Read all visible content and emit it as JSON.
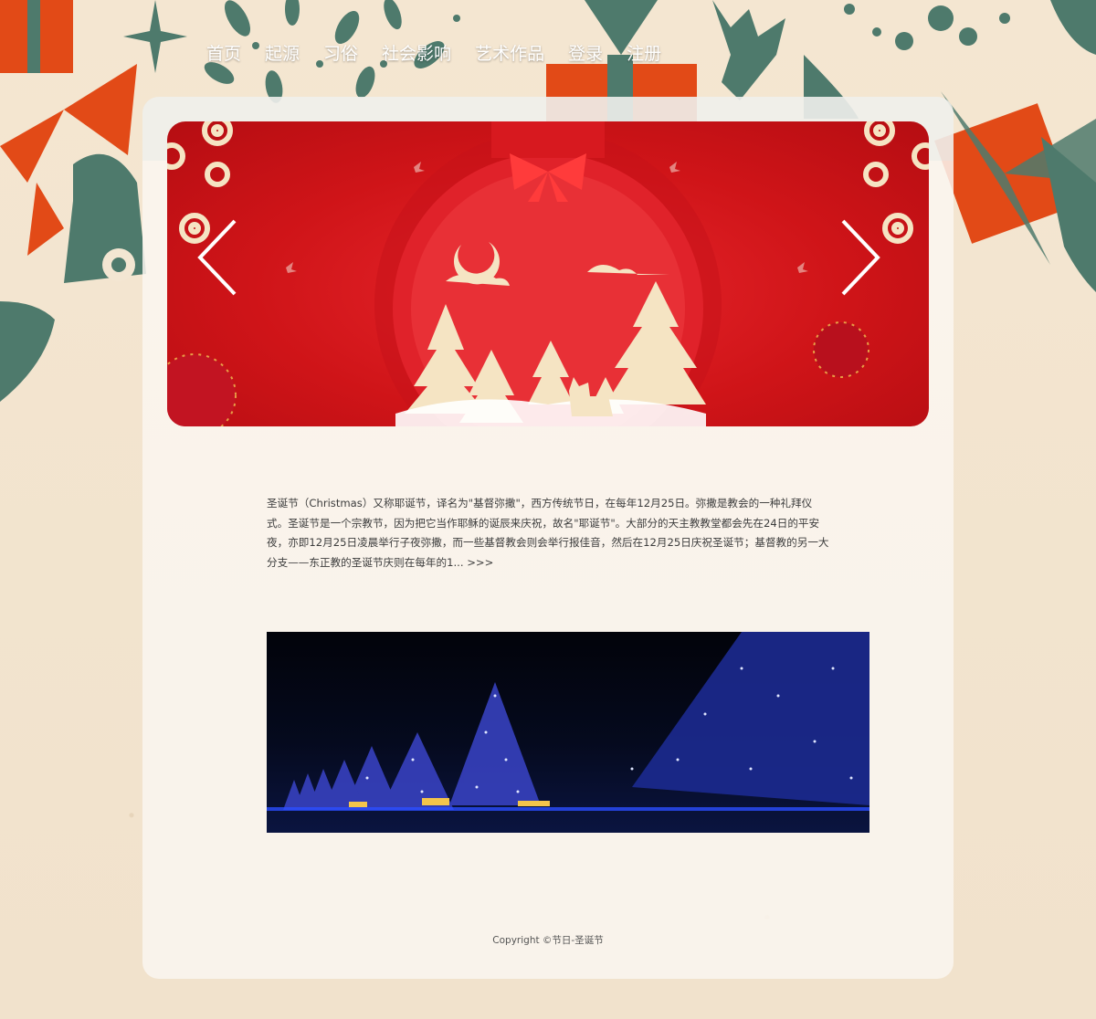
{
  "nav": {
    "items": [
      {
        "label": "首页"
      },
      {
        "label": "起源"
      },
      {
        "label": "习俗"
      },
      {
        "label": "社会影响"
      },
      {
        "label": "艺术作品"
      },
      {
        "label": "登录"
      },
      {
        "label": "注册"
      }
    ]
  },
  "banner": {
    "prev_icon": "chevron-left-icon",
    "next_icon": "chevron-right-icon"
  },
  "intro": {
    "text": "圣诞节（Christmas）又称耶诞节，译名为\"基督弥撒\"，西方传统节日，在每年12月25日。弥撒是教会的一种礼拜仪式。圣诞节是一个宗教节，因为把它当作耶稣的诞辰来庆祝，故名\"耶诞节\"。大部分的天主教教堂都会先在24日的平安夜，亦即12月25日凌晨举行子夜弥撒，而一些基督教会则会举行报佳音，然后在12月25日庆祝圣诞节；基督教的另一大分支——东正教的圣诞节庆则在每年的1...",
    "more": ">>>"
  },
  "footer": {
    "copyright": "Copyright ©节日-圣诞节"
  },
  "colors": {
    "background": "#f3e6d2",
    "decor_red": "#e24a17",
    "decor_teal": "#4e7a6c",
    "banner_red": "#cf1418"
  }
}
